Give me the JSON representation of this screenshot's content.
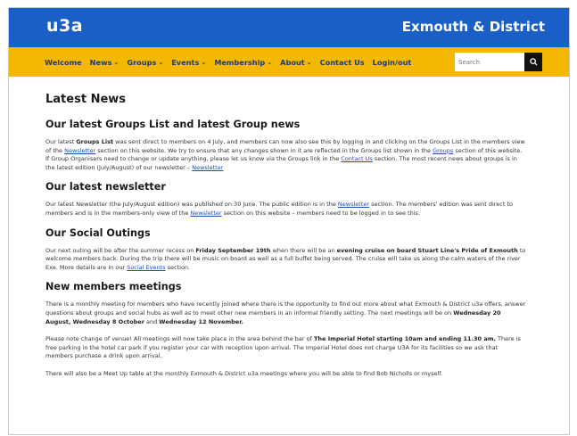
{
  "header": {
    "logo": "u3a",
    "site_title": "Exmouth & District"
  },
  "nav": {
    "items": [
      {
        "label": "Welcome",
        "dropdown": false
      },
      {
        "label": "News",
        "dropdown": true
      },
      {
        "label": "Groups",
        "dropdown": true
      },
      {
        "label": "Events",
        "dropdown": true
      },
      {
        "label": "Membership",
        "dropdown": true
      },
      {
        "label": "About",
        "dropdown": true
      },
      {
        "label": "Contact Us",
        "dropdown": false
      },
      {
        "label": "Login/out",
        "dropdown": false
      }
    ],
    "chevron": "⌄",
    "search_placeholder": "Search"
  },
  "colors": {
    "header_bg": "#1a5fc5",
    "nav_bg": "#f5b800",
    "link": "#1a4fb5"
  },
  "page": {
    "title": "Latest News",
    "sections": {
      "groups": {
        "heading": "Our latest Groups List and latest Group news",
        "t1": "Our latest ",
        "b1": "Groups List",
        "t2": " was sent direct to members on 4 July, and members can now also see this by logging in and clicking on the Groups List in the members view of the ",
        "l1": "Newsletter",
        "t3": " section on this website. We try to ensure that any changes shown in it are reflected in the Groups list shown in the ",
        "l2": "Groups",
        "t4": " section of this website. If Group Organisers need to change or update anything, please let us know via the Groups link in the ",
        "l3": "Contact Us",
        "t5": " section. The most recent news about groups is in the latest edition (July/August) of our newsletter – ",
        "l4": "Newsletter"
      },
      "newsletter": {
        "heading": "Our latest newsletter",
        "t1": "Our latest Newsletter (the July/August edition) was published on 30 June. The public edition is in the ",
        "l1": "Newsletter",
        "t2": " section. The members' edition was sent direct to members and is in the members-only view of the ",
        "l2": "Newsletter",
        "t3": " section on this website – members need to be logged in to see this."
      },
      "outings": {
        "heading": "Our Social Outings",
        "t1": "Our next outing will be after the summer recess on ",
        "b1": "Friday September 19th",
        "t2": " when there will be an ",
        "b2": "evening cruise on board Stuart Line's Pride of Exmouth",
        "t3": " to welcome members back. During the trip there will be music on board as well as a full buffet being served. The cruise will take us along the calm waters of the river Exe. More details are in our ",
        "l1": "Social Events",
        "t4": " section."
      },
      "members": {
        "heading": "New members meetings",
        "p1_t1": "There is a monthly meeting for members who have recently joined where there is the opportunity to find out more about what Exmouth & District u3a offers, answer questions about groups and social hubs as well as to meet other new members in an informal friendly setting. The next meetings will be on ",
        "p1_b1": "Wednesday 20 August, Wednesday 8 October",
        "p1_t2": " and ",
        "p1_b2": "Wednesday 12 November.",
        "p2_t1": "Please note change of venue! All meetings will now take place in the area behind the  bar of ",
        "p2_b1": "The Imperial Hotel starting 10am and ending 11.30 am.",
        "p2_t2": " There is free parking in the hotel car park if you register your car with reception upon arrival. The Imperial Hotel does not charge U3A for its facilities so we ask that members purchase a drink upon arrival.",
        "p3": "There will also be a Meet Up table at the monthly Exmouth & District u3a meetings where you will be able to find Bob Nicholls or myself."
      }
    }
  }
}
